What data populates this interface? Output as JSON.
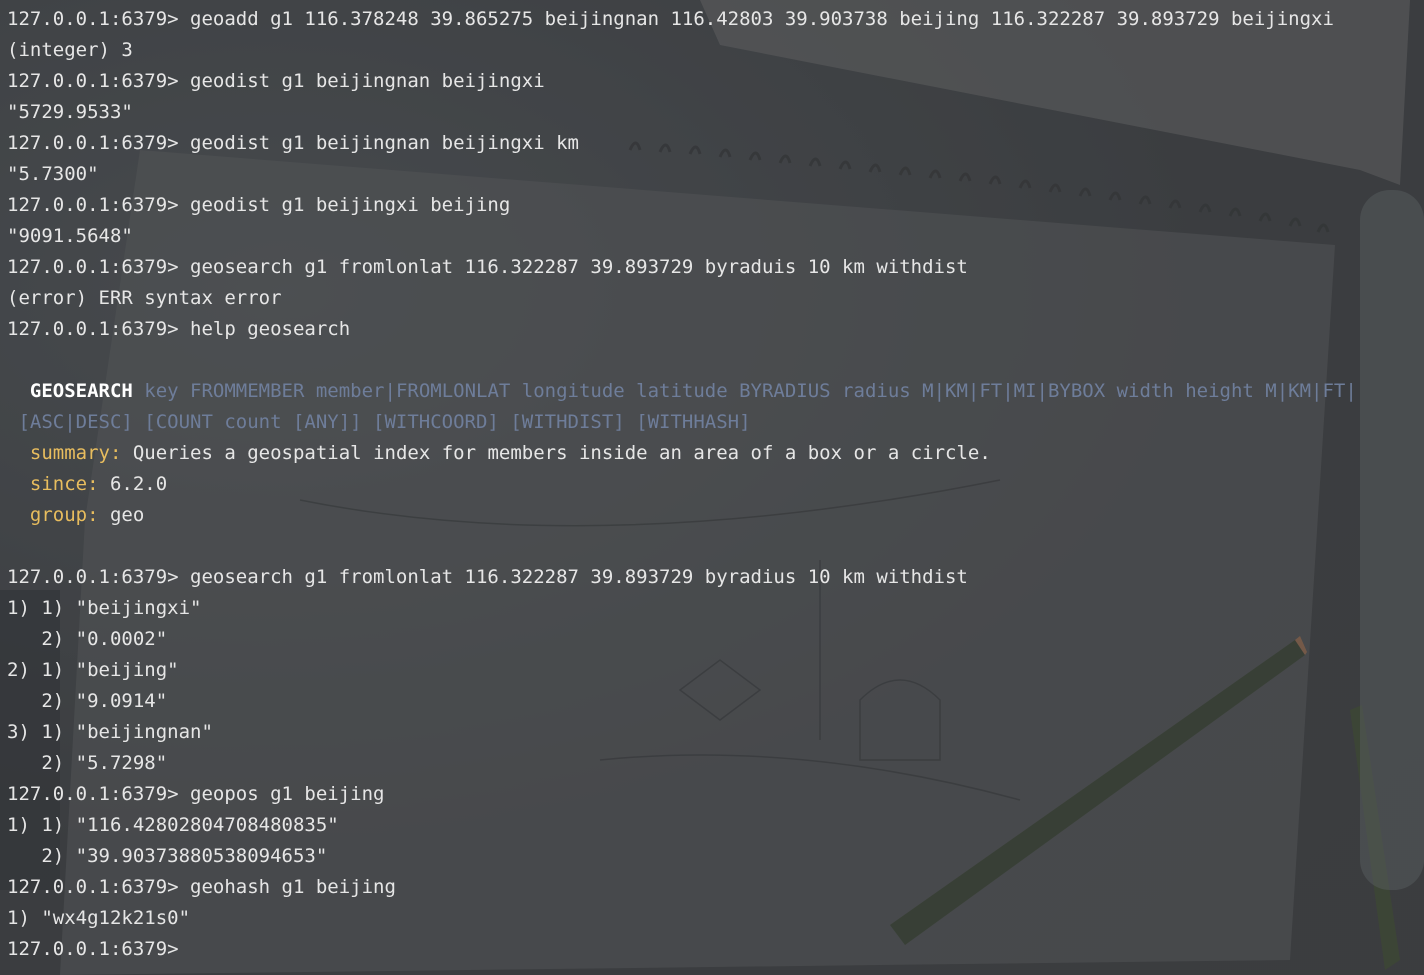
{
  "terminal": {
    "lines": [
      {
        "type": "text",
        "text": "127.0.0.1:6379> geoadd g1 116.378248 39.865275 beijingnan 116.42803 39.903738 beijing 116.322287 39.893729 beijingxi"
      },
      {
        "type": "text",
        "text": "(integer) 3"
      },
      {
        "type": "text",
        "text": "127.0.0.1:6379> geodist g1 beijingnan beijingxi"
      },
      {
        "type": "text",
        "text": "\"5729.9533\""
      },
      {
        "type": "text",
        "text": "127.0.0.1:6379> geodist g1 beijingnan beijingxi km"
      },
      {
        "type": "text",
        "text": "\"5.7300\""
      },
      {
        "type": "text",
        "text": "127.0.0.1:6379> geodist g1 beijingxi beijing"
      },
      {
        "type": "text",
        "text": "\"9091.5648\""
      },
      {
        "type": "text",
        "text": "127.0.0.1:6379> geosearch g1 fromlonlat 116.322287 39.893729 byraduis 10 km withdist"
      },
      {
        "type": "text",
        "text": "(error) ERR syntax error"
      },
      {
        "type": "text",
        "text": "127.0.0.1:6379> help geosearch"
      },
      {
        "type": "text",
        "text": ""
      },
      {
        "type": "help-head",
        "name": "  GEOSEARCH",
        "args": " key FROMMEMBER member|FROMLONLAT longitude latitude BYRADIUS radius M|KM|FT|MI|BYBOX width height M|KM|FT|"
      },
      {
        "type": "help-args",
        "text": " [ASC|DESC] [COUNT count [ANY]] [WITHCOORD] [WITHDIST] [WITHHASH]"
      },
      {
        "type": "help-field",
        "indent": "  ",
        "key": "summary:",
        "value": " Queries a geospatial index for members inside an area of a box or a circle."
      },
      {
        "type": "help-field",
        "indent": "  ",
        "key": "since:",
        "value": " 6.2.0"
      },
      {
        "type": "help-field",
        "indent": "  ",
        "key": "group:",
        "value": " geo"
      },
      {
        "type": "text",
        "text": ""
      },
      {
        "type": "text",
        "text": "127.0.0.1:6379> geosearch g1 fromlonlat 116.322287 39.893729 byradius 10 km withdist"
      },
      {
        "type": "text",
        "text": "1) 1) \"beijingxi\""
      },
      {
        "type": "text",
        "text": "   2) \"0.0002\""
      },
      {
        "type": "text",
        "text": "2) 1) \"beijing\""
      },
      {
        "type": "text",
        "text": "   2) \"9.0914\""
      },
      {
        "type": "text",
        "text": "3) 1) \"beijingnan\""
      },
      {
        "type": "text",
        "text": "   2) \"5.7298\""
      },
      {
        "type": "text",
        "text": "127.0.0.1:6379> geopos g1 beijing"
      },
      {
        "type": "text",
        "text": "1) 1) \"116.42802804708480835\""
      },
      {
        "type": "text",
        "text": "   2) \"39.90373880538094653\""
      },
      {
        "type": "text",
        "text": "127.0.0.1:6379> geohash g1 beijing"
      },
      {
        "type": "text",
        "text": "1) \"wx4g12k21s0\""
      },
      {
        "type": "prompt",
        "text": "127.0.0.1:6379> "
      }
    ]
  },
  "colors": {
    "text": "#e6e6e6",
    "help_name": "#ffffff",
    "help_args": "#6e7d9a",
    "help_key": "#e8bd5e"
  }
}
